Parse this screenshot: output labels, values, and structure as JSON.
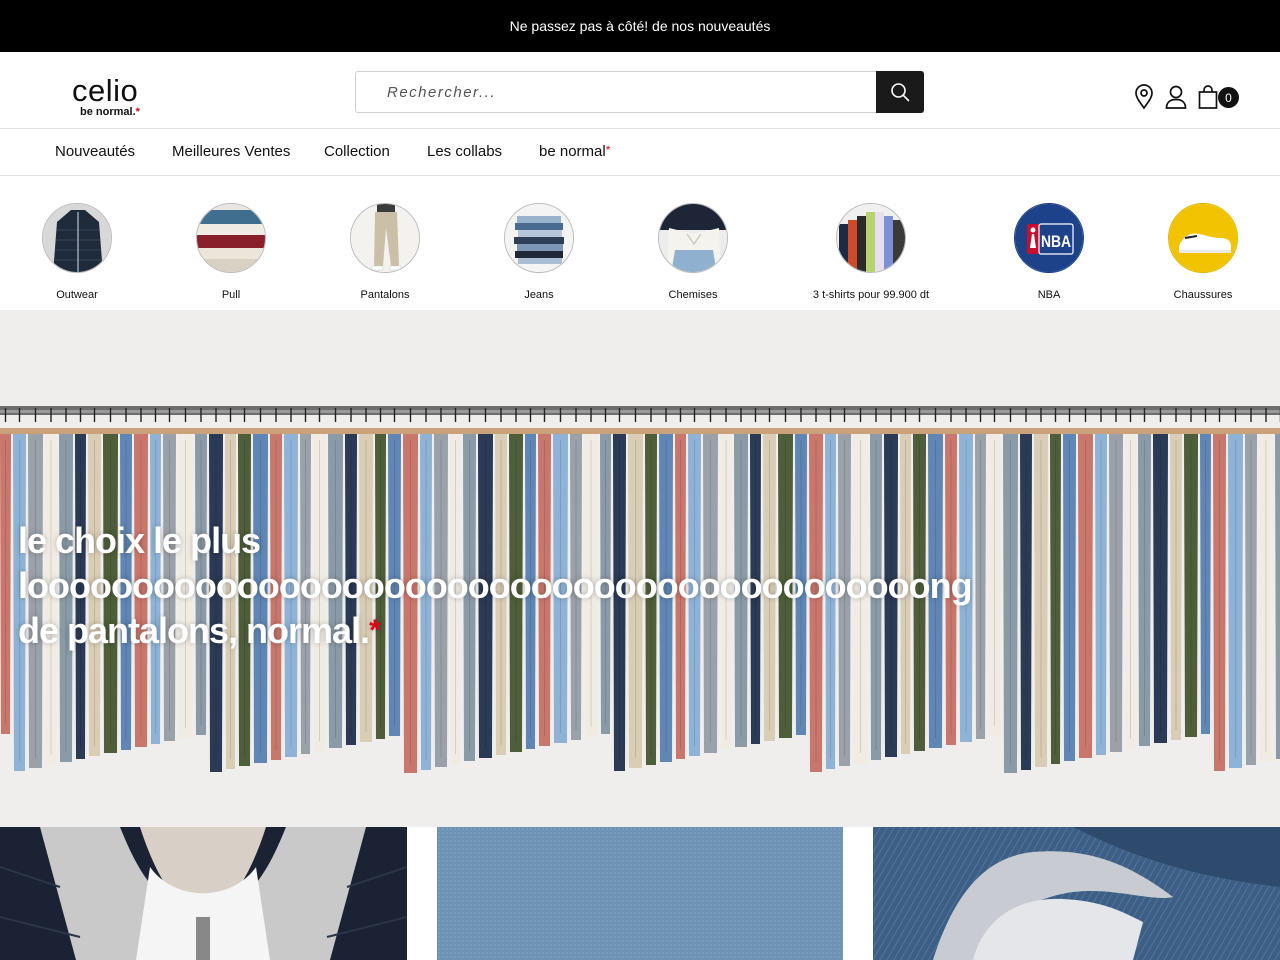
{
  "topbar": {
    "message": "Ne passez pas à côté! de nos nouveautés"
  },
  "header": {
    "logo": {
      "brand": "celio",
      "tagline": "be normal.",
      "tagline_star": "*"
    },
    "search": {
      "placeholder": "Rechercher..."
    },
    "cart_count": "0"
  },
  "nav": {
    "items": [
      {
        "label": "Nouveautés"
      },
      {
        "label": "Meilleures Ventes"
      },
      {
        "label": "Collection"
      },
      {
        "label": "Les collabs"
      },
      {
        "label": "be normal",
        "star": "*"
      }
    ]
  },
  "categories": [
    {
      "label": "Outwear"
    },
    {
      "label": "Pull"
    },
    {
      "label": "Pantalons"
    },
    {
      "label": "Jeans"
    },
    {
      "label": "Chemises"
    },
    {
      "label": "3 t-shirts pour 99.900 dt"
    },
    {
      "label": "NBA"
    },
    {
      "label": "Chaussures"
    }
  ],
  "hero": {
    "line1": "le choix le plus",
    "line2": "looooooooooooooooooooooooooooooooooooooooooong",
    "line3": "de pantalons, normal.",
    "star": "*"
  },
  "colors": {
    "accent_red": "#e0001a",
    "dark": "#111111",
    "hero_bg": "#efeeec"
  }
}
